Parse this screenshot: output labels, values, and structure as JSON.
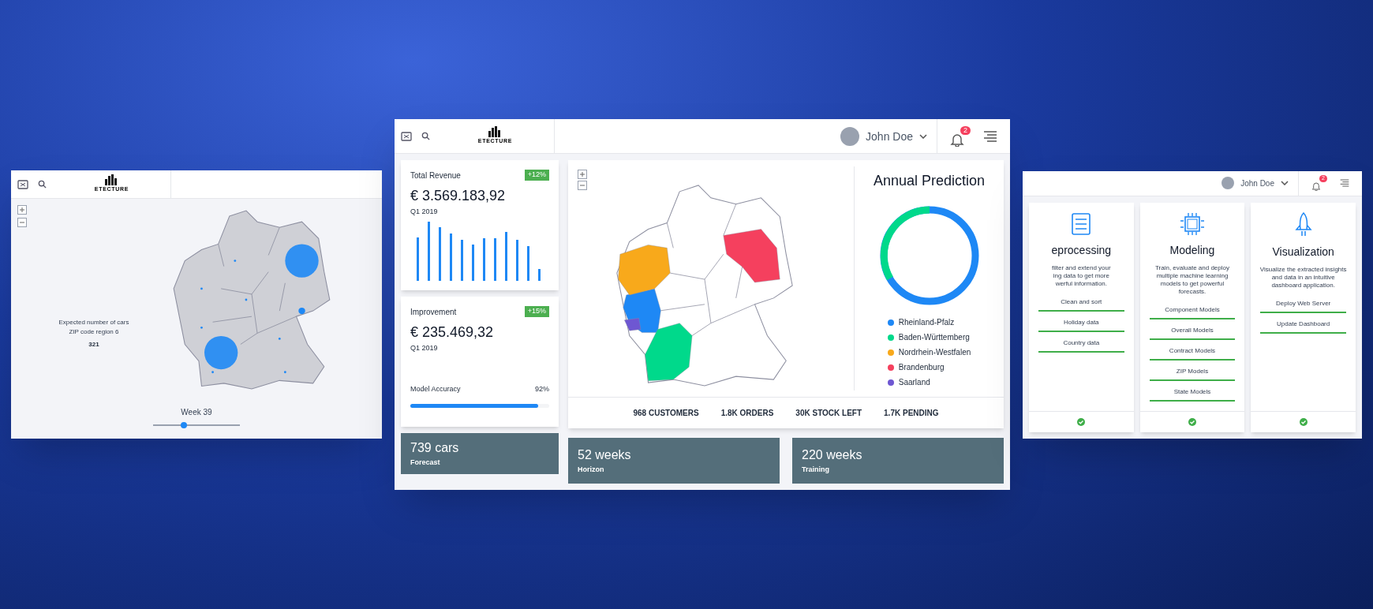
{
  "left_screen": {
    "logo": "ETECTURE",
    "map_tooltip": {
      "lines": [
        "Expected number of cars",
        "ZIP code region 6"
      ],
      "value": "321"
    },
    "week_label": "Week 39",
    "week_slider": {
      "level": 0.35
    }
  },
  "main_screen": {
    "logo": "ETECTURE",
    "user": {
      "name": "John Doe"
    },
    "notifications": {
      "count": "2"
    },
    "kpi_cards": [
      {
        "title": "Total Revenue",
        "badge": "+12%",
        "amount": "€ 3.569.183,92",
        "period": "Q1 2019"
      },
      {
        "title": "Improvement",
        "badge": "+15%",
        "amount": "€ 235.469,32",
        "period": "Q1 2019",
        "metric": {
          "label": "Model Accuracy",
          "reading": "92%",
          "level": 0.92
        }
      }
    ],
    "prediction": {
      "title": "Annual Prediction",
      "legend": [
        {
          "label": "Rheinland-Pfalz",
          "color": "#1e88f5"
        },
        {
          "label": "Baden-Württemberg",
          "color": "#00d98b"
        },
        {
          "label": "Nordrhein-Westfalen",
          "color": "#f8a91b"
        },
        {
          "label": "Brandenburg",
          "color": "#f5405e"
        },
        {
          "label": "Saarland",
          "color": "#6e57d2"
        }
      ]
    },
    "stats": [
      "968 CUSTOMERS",
      "1.8K ORDERS",
      "30K STOCK LEFT",
      "1.7K PENDING"
    ],
    "tiles": [
      {
        "value": "739 cars",
        "label": "Forecast"
      },
      {
        "value": "52 weeks",
        "label": "Horizon"
      },
      {
        "value": "220 weeks",
        "label": "Training"
      }
    ]
  },
  "right_screen": {
    "user": {
      "name": "John Doe"
    },
    "notifications": {
      "count": "2"
    },
    "cards": [
      {
        "title": "eprocessing",
        "description": [
          "filter and extend your",
          "ing data to get more",
          "werful information."
        ],
        "steps": [
          "Clean and sort",
          "Holiday data",
          "Country data"
        ]
      },
      {
        "title": "Modeling",
        "description": [
          "Train, evaluate and deploy",
          "multiple machine learning",
          "models to get powerful",
          "forecasts."
        ],
        "steps": [
          "Component Models",
          "Overall Models",
          "Contract Models",
          "ZIP Models",
          "State Models"
        ]
      },
      {
        "title": "Visualization",
        "description": [
          "Visualize the extracted insights",
          "and data in an intuitive",
          "dashboard application."
        ],
        "steps": [
          "Deploy Web Server",
          "Update Dashboard"
        ]
      }
    ]
  }
}
